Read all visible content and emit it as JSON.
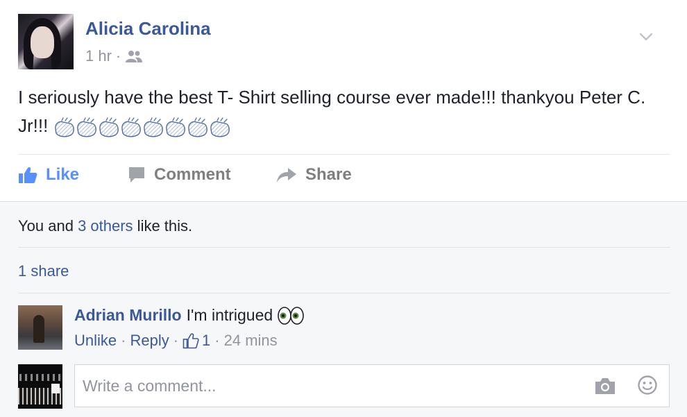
{
  "post": {
    "author": "Alicia Carolina",
    "time": "1 hr",
    "meta_separator": "·",
    "audience_icon": "friends-icon",
    "text_main": "I seriously have the best T- Shirt selling course ever made!!! thankyou Peter C. Jr!!!",
    "text_emoji": "clapping-hands emoji ×8"
  },
  "actions": {
    "like": "Like",
    "comment": "Comment",
    "share": "Share"
  },
  "feedback": {
    "likes_prefix": "You and ",
    "likes_link": "3 others",
    "likes_suffix": " like this.",
    "shares": "1 share"
  },
  "comment": {
    "author": "Adrian Murillo",
    "text": "I'm intrigued",
    "emoji": "eyes emoji",
    "unlike": "Unlike",
    "reply": "Reply",
    "like_count": "1",
    "time": "24 mins",
    "separator": "·"
  },
  "composer": {
    "placeholder": "Write a comment..."
  },
  "colors": {
    "name_blue": "#3b5998",
    "like_blue": "#5890ff",
    "muted_gray": "#90949c",
    "action_gray": "#7f7f7f",
    "panel_bg": "#f6f7f9"
  }
}
